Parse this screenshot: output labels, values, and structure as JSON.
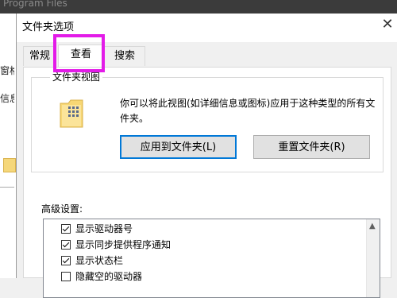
{
  "background": {
    "window_title": "Program Files",
    "sidebar_fragments": [
      "窗格",
      "信息"
    ]
  },
  "dialog": {
    "title": "文件夹选项",
    "close_glyph": "✕",
    "tabs": [
      {
        "label": "常规",
        "active": false
      },
      {
        "label": "查看",
        "active": true
      },
      {
        "label": "搜索",
        "active": false
      }
    ],
    "folder_view": {
      "label": "文件夹视图",
      "description": "你可以将此视图(如详细信息或图标)应用于这种类型的所有文件夹。",
      "apply_button": "应用到文件夹(L)",
      "reset_button": "重置文件夹(R)"
    },
    "advanced": {
      "label": "高级设置:",
      "items": [
        {
          "label": "显示驱动器号",
          "checked": true
        },
        {
          "label": "显示同步提供程序通知",
          "checked": true
        },
        {
          "label": "显示状态栏",
          "checked": true
        },
        {
          "label": "隐藏空的驱动器",
          "checked": false
        }
      ],
      "scroll_up_glyph": "▲"
    }
  },
  "colors": {
    "highlight": "#e31be8",
    "primary_button_border": "#0078d7"
  }
}
